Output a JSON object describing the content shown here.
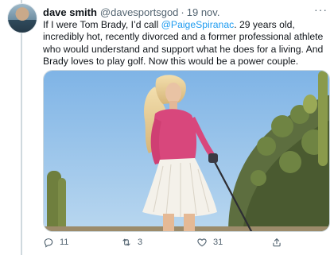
{
  "tweet": {
    "author_name": "dave smith",
    "author_handle": "@davesportsgod",
    "separator": "·",
    "date": "19 nov.",
    "more_label": "···",
    "text_before_mention": "If I were Tom Brady, I’d call ",
    "mention": "@PaigeSpiranac",
    "text_after_mention": ". 29 years old, incredibly hot, recently divorced and a former professional athlete who would understand and support what he does for a living. And Brady loves to play golf. Now this would be a power couple."
  },
  "actions": {
    "reply_count": "11",
    "retweet_count": "3",
    "like_count": "31",
    "icons": [
      "reply-icon",
      "retweet-icon",
      "like-icon",
      "share-icon"
    ]
  },
  "colors": {
    "link": "#1d9bf0",
    "secondary_text": "#536471",
    "sky": "#8fc0ea"
  }
}
